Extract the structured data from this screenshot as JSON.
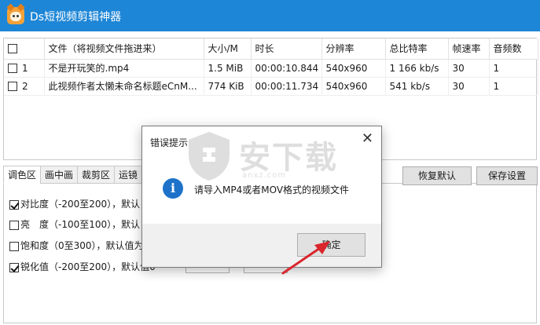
{
  "app": {
    "title": "Ds短视频剪辑神器"
  },
  "table": {
    "headers": [
      "",
      "文件（将视频文件拖进来）",
      "大小/M",
      "时长",
      "分辨率",
      "总比特率",
      "帧速率",
      "音频数"
    ],
    "rows": [
      {
        "index": "1",
        "name": "不是开玩笑的.mp4",
        "size": "1.5 MiB",
        "duration": "00:00:10.844",
        "resolution": "540x960",
        "bitrate": "1 166 kb/s",
        "fps": "30",
        "audio": "1"
      },
      {
        "index": "2",
        "name": "此视频作者太懒未命名标题eCnM...",
        "size": "774 KiB",
        "duration": "00:00:11.734",
        "resolution": "540x960",
        "bitrate": "541 kb/s",
        "fps": "30",
        "audio": "1"
      }
    ]
  },
  "tabs": [
    "调色区",
    "画中画",
    "裁剪区",
    "运镜"
  ],
  "buttons": {
    "restore_default": "恢复默认",
    "save_settings": "保存设置"
  },
  "settings": [
    {
      "label": "对比度（-200至200），默认",
      "checked": true
    },
    {
      "label": "亮　度（-100至100），默认",
      "checked": false
    },
    {
      "label": "饱和度（0至300），默认值为",
      "checked": false
    },
    {
      "label": "锐化值（-200至200），默认值0",
      "checked": true
    }
  ],
  "dialog": {
    "title": "错误提示",
    "close": "✕",
    "message": "请导入MP4或者MOV格式的视频文件",
    "icon": "info-icon",
    "ok_label": "确定"
  },
  "watermark": {
    "text": "安下载",
    "sub": "anxz.com"
  },
  "colors": {
    "titlebar": "#1e86d6",
    "info_icon": "#1e72c9",
    "arrow": "#d9262c"
  }
}
